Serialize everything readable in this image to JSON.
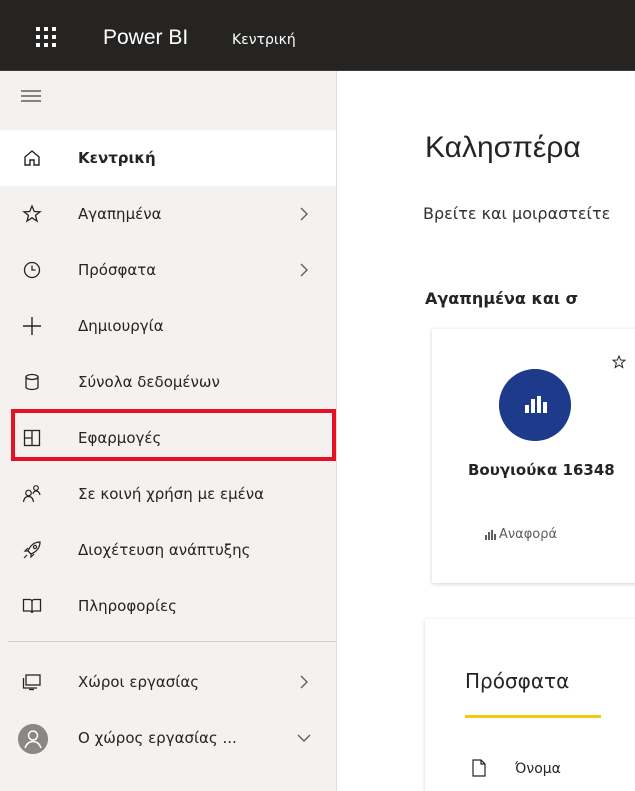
{
  "topbar": {
    "brand": "Power BI",
    "breadcrumb": "Κεντρική"
  },
  "sidebar": {
    "items": [
      {
        "label": "Κεντρική",
        "icon": "home-icon",
        "active": true
      },
      {
        "label": "Αγαπημένα",
        "icon": "star-icon",
        "chevron": "right"
      },
      {
        "label": "Πρόσφατα",
        "icon": "clock-icon",
        "chevron": "right"
      },
      {
        "label": "Δημιουργία",
        "icon": "plus-icon"
      },
      {
        "label": "Σύνολα δεδομένων",
        "icon": "database-icon"
      },
      {
        "label": "Εφαρμογές",
        "icon": "apps-icon",
        "highlighted": true
      },
      {
        "label": "Σε κοινή χρήση με εμένα",
        "icon": "shared-icon"
      },
      {
        "label": "Διοχέτευση ανάπτυξης",
        "icon": "rocket-icon"
      },
      {
        "label": "Πληροφορίες",
        "icon": "book-icon"
      },
      {
        "label": "Χώροι εργασίας",
        "icon": "workspaces-icon",
        "chevron": "right"
      },
      {
        "label": "Ο χώρος εργασίας ...",
        "icon": "avatar",
        "chevron": "down"
      }
    ]
  },
  "main": {
    "greeting": "Καλησπέρα",
    "subtitle": "Βρείτε και μοιραστείτε",
    "favorites_heading": "Αγαπημένα και σ",
    "card": {
      "title": "Βουγιούκα 16348",
      "type": "Αναφορά"
    },
    "recent": {
      "title": "Πρόσφατα",
      "column_name": "Όνομα"
    }
  },
  "colors": {
    "topbar": "#252423",
    "sidebar": "#f3f2f1",
    "highlight": "#e81123",
    "card_icon": "#1e3a8a",
    "tab_underline": "#f2c811"
  }
}
